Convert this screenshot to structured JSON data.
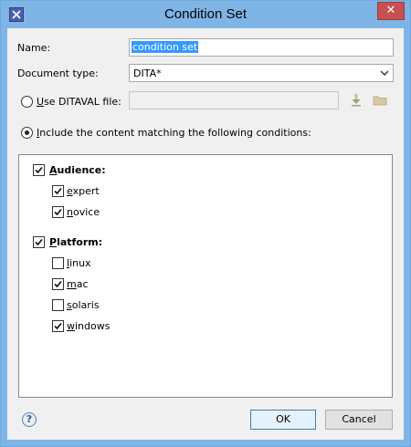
{
  "window": {
    "title": "Condition Set",
    "close_glyph": "✕",
    "app_icon": "x-app-icon"
  },
  "form": {
    "name_label": "Name:",
    "name_value": "condition set",
    "doctype_label": "Document type:",
    "doctype_value": "DITA*",
    "use_ditaval_label_mnemonic": "U",
    "use_ditaval_label_rest": "se DITAVAL file:",
    "use_ditaval_value": "",
    "include_label_mnemonic": "I",
    "include_label_rest": "nclude the content matching the following conditions:"
  },
  "conditions": {
    "audience": {
      "label_mnemonic": "A",
      "label_rest": "udience:",
      "checked": true,
      "values": [
        {
          "mnemonic": "e",
          "rest": "xpert",
          "checked": true
        },
        {
          "mnemonic": "n",
          "rest": "ovice",
          "checked": true
        }
      ]
    },
    "platform": {
      "label_mnemonic": "P",
      "label_rest": "latform:",
      "checked": true,
      "values": [
        {
          "mnemonic": "l",
          "rest": "inux",
          "checked": false
        },
        {
          "mnemonic": "m",
          "rest": "ac",
          "checked": true
        },
        {
          "mnemonic": "s",
          "rest": "olaris",
          "checked": false
        },
        {
          "mnemonic": "w",
          "rest": "indows",
          "checked": true
        }
      ]
    }
  },
  "buttons": {
    "ok_label": "OK",
    "cancel_label": "Cancel",
    "help_glyph": "?"
  },
  "colors": {
    "titlebar": "#7fb5e6",
    "selection": "#3399ff",
    "close": "#c75050"
  }
}
